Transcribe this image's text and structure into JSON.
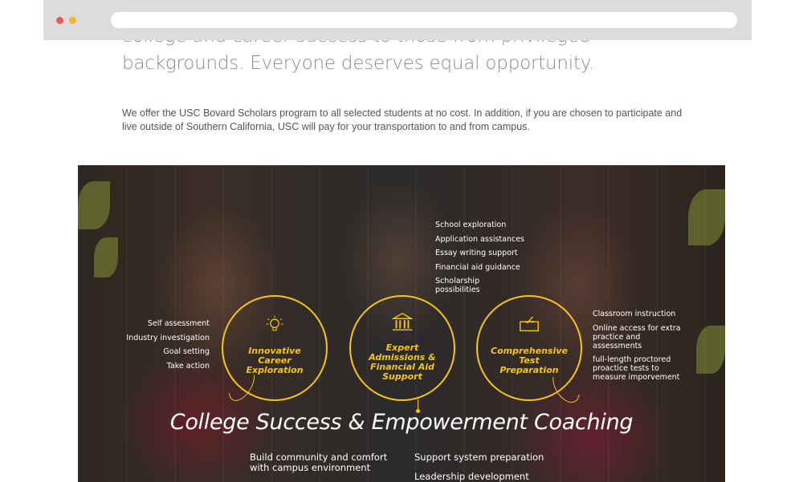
{
  "intro": {
    "lead": "college and career success to those from privileged backgrounds. Everyone deserves equal opportunity.",
    "body": "We offer the USC Bovard Scholars program to all selected students at no cost. In addition, if you are chosen to participate and live outside of Southern California, USC will pay for your transportation to and from campus."
  },
  "colors": {
    "accent": "#f5c518",
    "text_light": "#8c8c8c",
    "hero_bg": "#2d2620"
  },
  "circles": [
    {
      "label": "Innovative Career Exploration",
      "icon": "lightbulb-icon"
    },
    {
      "label": "Expert Admissions & Financial Aid Support",
      "icon": "building-icon"
    },
    {
      "label": "Comprehensive Test Preparation",
      "icon": "ballot-box-icon"
    }
  ],
  "career_list": [
    "Self assessment",
    "Industry investigation",
    "Goal setting",
    "Take action"
  ],
  "admissions_list": [
    "School exploration",
    "Application assistances",
    "Essay writing support",
    "Financial aid guidance",
    "Scholarship possibilities"
  ],
  "test_list": [
    "Classroom instruction",
    "Online access for extra practice and assessments",
    "full-length proctored proactice tests to measure imporvement"
  ],
  "coaching": {
    "title": "College Success & Empowerment Coaching",
    "items": [
      "Build community and comfort with campus environment",
      "Support system preparation",
      "Leadership development"
    ]
  }
}
